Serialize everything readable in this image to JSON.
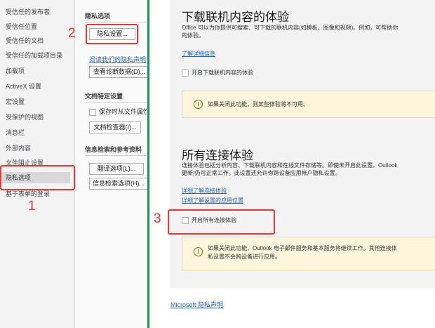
{
  "nav": {
    "items": [
      "受信任的发布者",
      "受信任位置",
      "受信任的文档",
      "受信任的加载项目录",
      "加载项",
      "ActiveX 设置",
      "宏设置",
      "受保护的视图",
      "消息栏",
      "外部内容",
      "文件阻止设置",
      "隐私选项",
      "基于表单的登录"
    ],
    "selected_index": 11
  },
  "mid": {
    "privacy_title": "隐私选项",
    "privacy_settings_button": "隐私设置...",
    "read_privacy_link": "阅读我们的隐私声明",
    "view_diag_button": "查看诊断数据(D)...",
    "doc_specific_title": "文档特定设置",
    "remove_personal_info": "保存时从文件属性中删除",
    "doc_inspector_button": "文档检查器(I)...",
    "research_title": "信息检索和参考资料",
    "translate_button": "翻译选项(L)...",
    "research_button": "信息检索选项(H)..."
  },
  "right": {
    "download_heading": "下载联机内容的体验",
    "download_body_1": "Office 可以为你提供可搜索、可下载的联机内容(如模板、图像和视频)。例如，可帮助你",
    "download_body_2": "的体验。",
    "learn_more_link": "了解详细信息",
    "enable_download_label": "开启下载联机内容的体验",
    "download_info": "如果关闭此功能，则某些体验将不可用。",
    "connected_heading": "所有连接体验",
    "connected_body_1": "连接体验包括分析内容、下载联机内容和在线文件存储等。即使未开启此设置，Outlook",
    "connected_body_2": "更新)仍可正常工作。此设置还允许你跨设备应用帐户隐私设置。",
    "learn_connected_link": "详细了解连接体验",
    "learn_settings_link": "详细了解设置的应用位置",
    "enable_connected_label": "开启所有连接体验",
    "connected_info_1": "如果关闭此功能，Outlook 电子邮件服务和基本服务将继续工作。其他连接体",
    "connected_info_2": "私设置不会跨设备进行应用。",
    "ms_privacy_link": "Microsoft 隐私声明"
  },
  "annotations": {
    "one": "1",
    "two": "2",
    "three": "3",
    "color": "#e53935"
  },
  "colors": {
    "link": "#2b65b0",
    "info_bg": "#fdf6dc",
    "divider": "#2e8b57"
  },
  "icons": {
    "info": "info-icon"
  }
}
